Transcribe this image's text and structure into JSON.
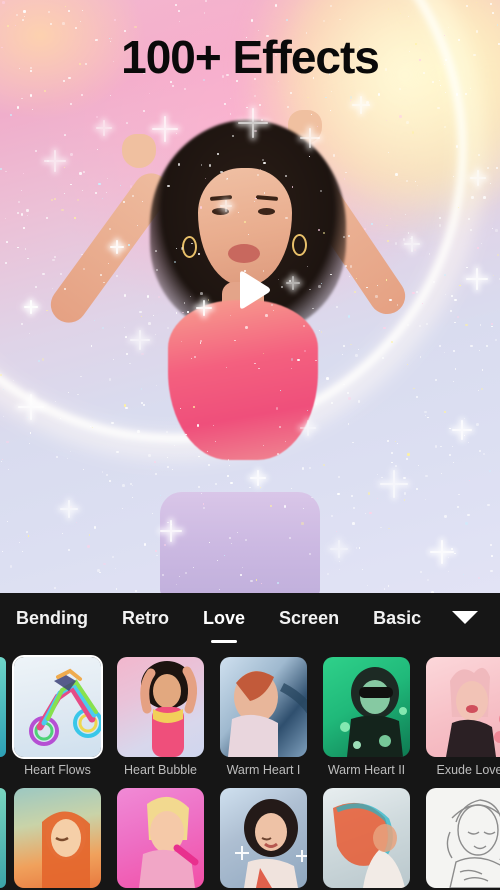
{
  "header": {
    "title": "100+ Effects"
  },
  "preview": {
    "play_icon": "play-icon",
    "subject_description": "woman dancing with raised arms, pink crop top",
    "effect_applied": "sparkle glitter halo"
  },
  "panel": {
    "tabs": [
      {
        "label": "Bending",
        "active": false
      },
      {
        "label": "Retro",
        "active": false
      },
      {
        "label": "Love",
        "active": true
      },
      {
        "label": "Screen",
        "active": false
      },
      {
        "label": "Basic",
        "active": false
      }
    ],
    "expand_icon": "chevron-down-icon",
    "rows": [
      {
        "items": [
          {
            "label": "",
            "selected": false,
            "partial": true,
            "art": "sliver"
          },
          {
            "label": "Heart Flows",
            "selected": true,
            "art": "motorcycle-rainbow"
          },
          {
            "label": "Heart Bubble",
            "selected": false,
            "art": "woman-pink-dance"
          },
          {
            "label": "Warm Heart I",
            "selected": false,
            "art": "woman-blue-profile"
          },
          {
            "label": "Warm Heart II",
            "selected": false,
            "art": "woman-green-sunglasses"
          },
          {
            "label": "Exude Love",
            "selected": false,
            "art": "woman-pink-blonde"
          }
        ]
      },
      {
        "items": [
          {
            "label": "",
            "selected": false,
            "partial": true,
            "art": "sliver2"
          },
          {
            "label": "",
            "selected": false,
            "art": "woman-orange-field"
          },
          {
            "label": "",
            "selected": false,
            "art": "woman-magenta-neon"
          },
          {
            "label": "",
            "selected": false,
            "art": "woman-white-sparkle"
          },
          {
            "label": "",
            "selected": false,
            "art": "woman-glitch-red"
          },
          {
            "label": "",
            "selected": false,
            "art": "woman-pencil-sketch"
          }
        ]
      }
    ]
  },
  "colors": {
    "panel_bg": "#161616",
    "tab_active": "#ffffff",
    "tab_inactive": "#f2f2f2",
    "caption": "#bdbdbd",
    "title_text": "#0a0a0a"
  }
}
